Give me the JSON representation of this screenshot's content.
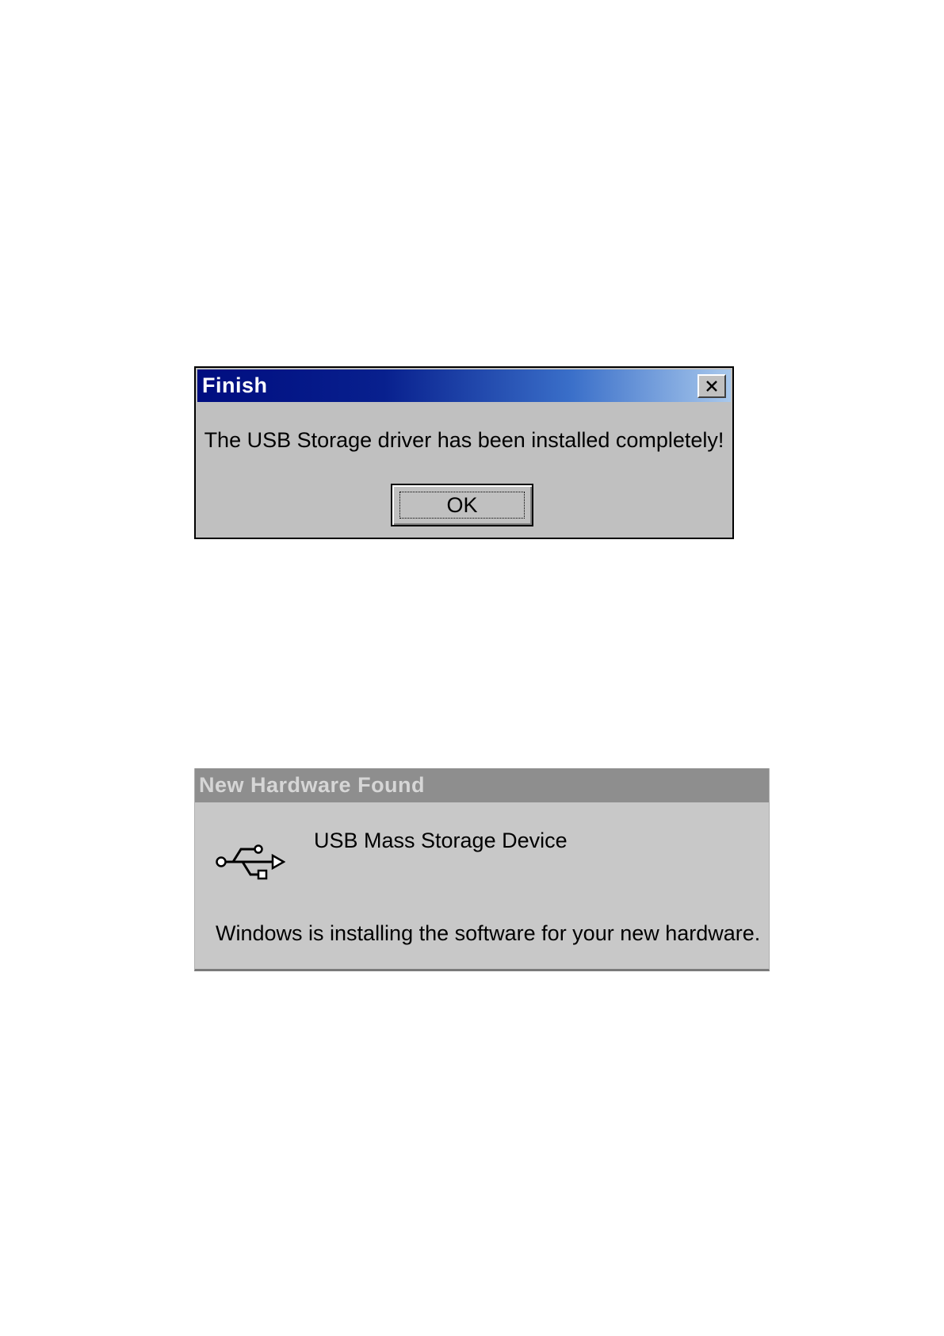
{
  "finish_dialog": {
    "title": "Finish",
    "message": "The USB Storage driver has been installed completely!",
    "ok_label": "OK",
    "close_icon": "close-icon",
    "title_color": "#000d80"
  },
  "hardware_panel": {
    "title": "New Hardware Found",
    "device_name": "USB Mass Storage Device",
    "status": "Windows is installing the software for your new hardware.",
    "icon": "usb-icon"
  }
}
